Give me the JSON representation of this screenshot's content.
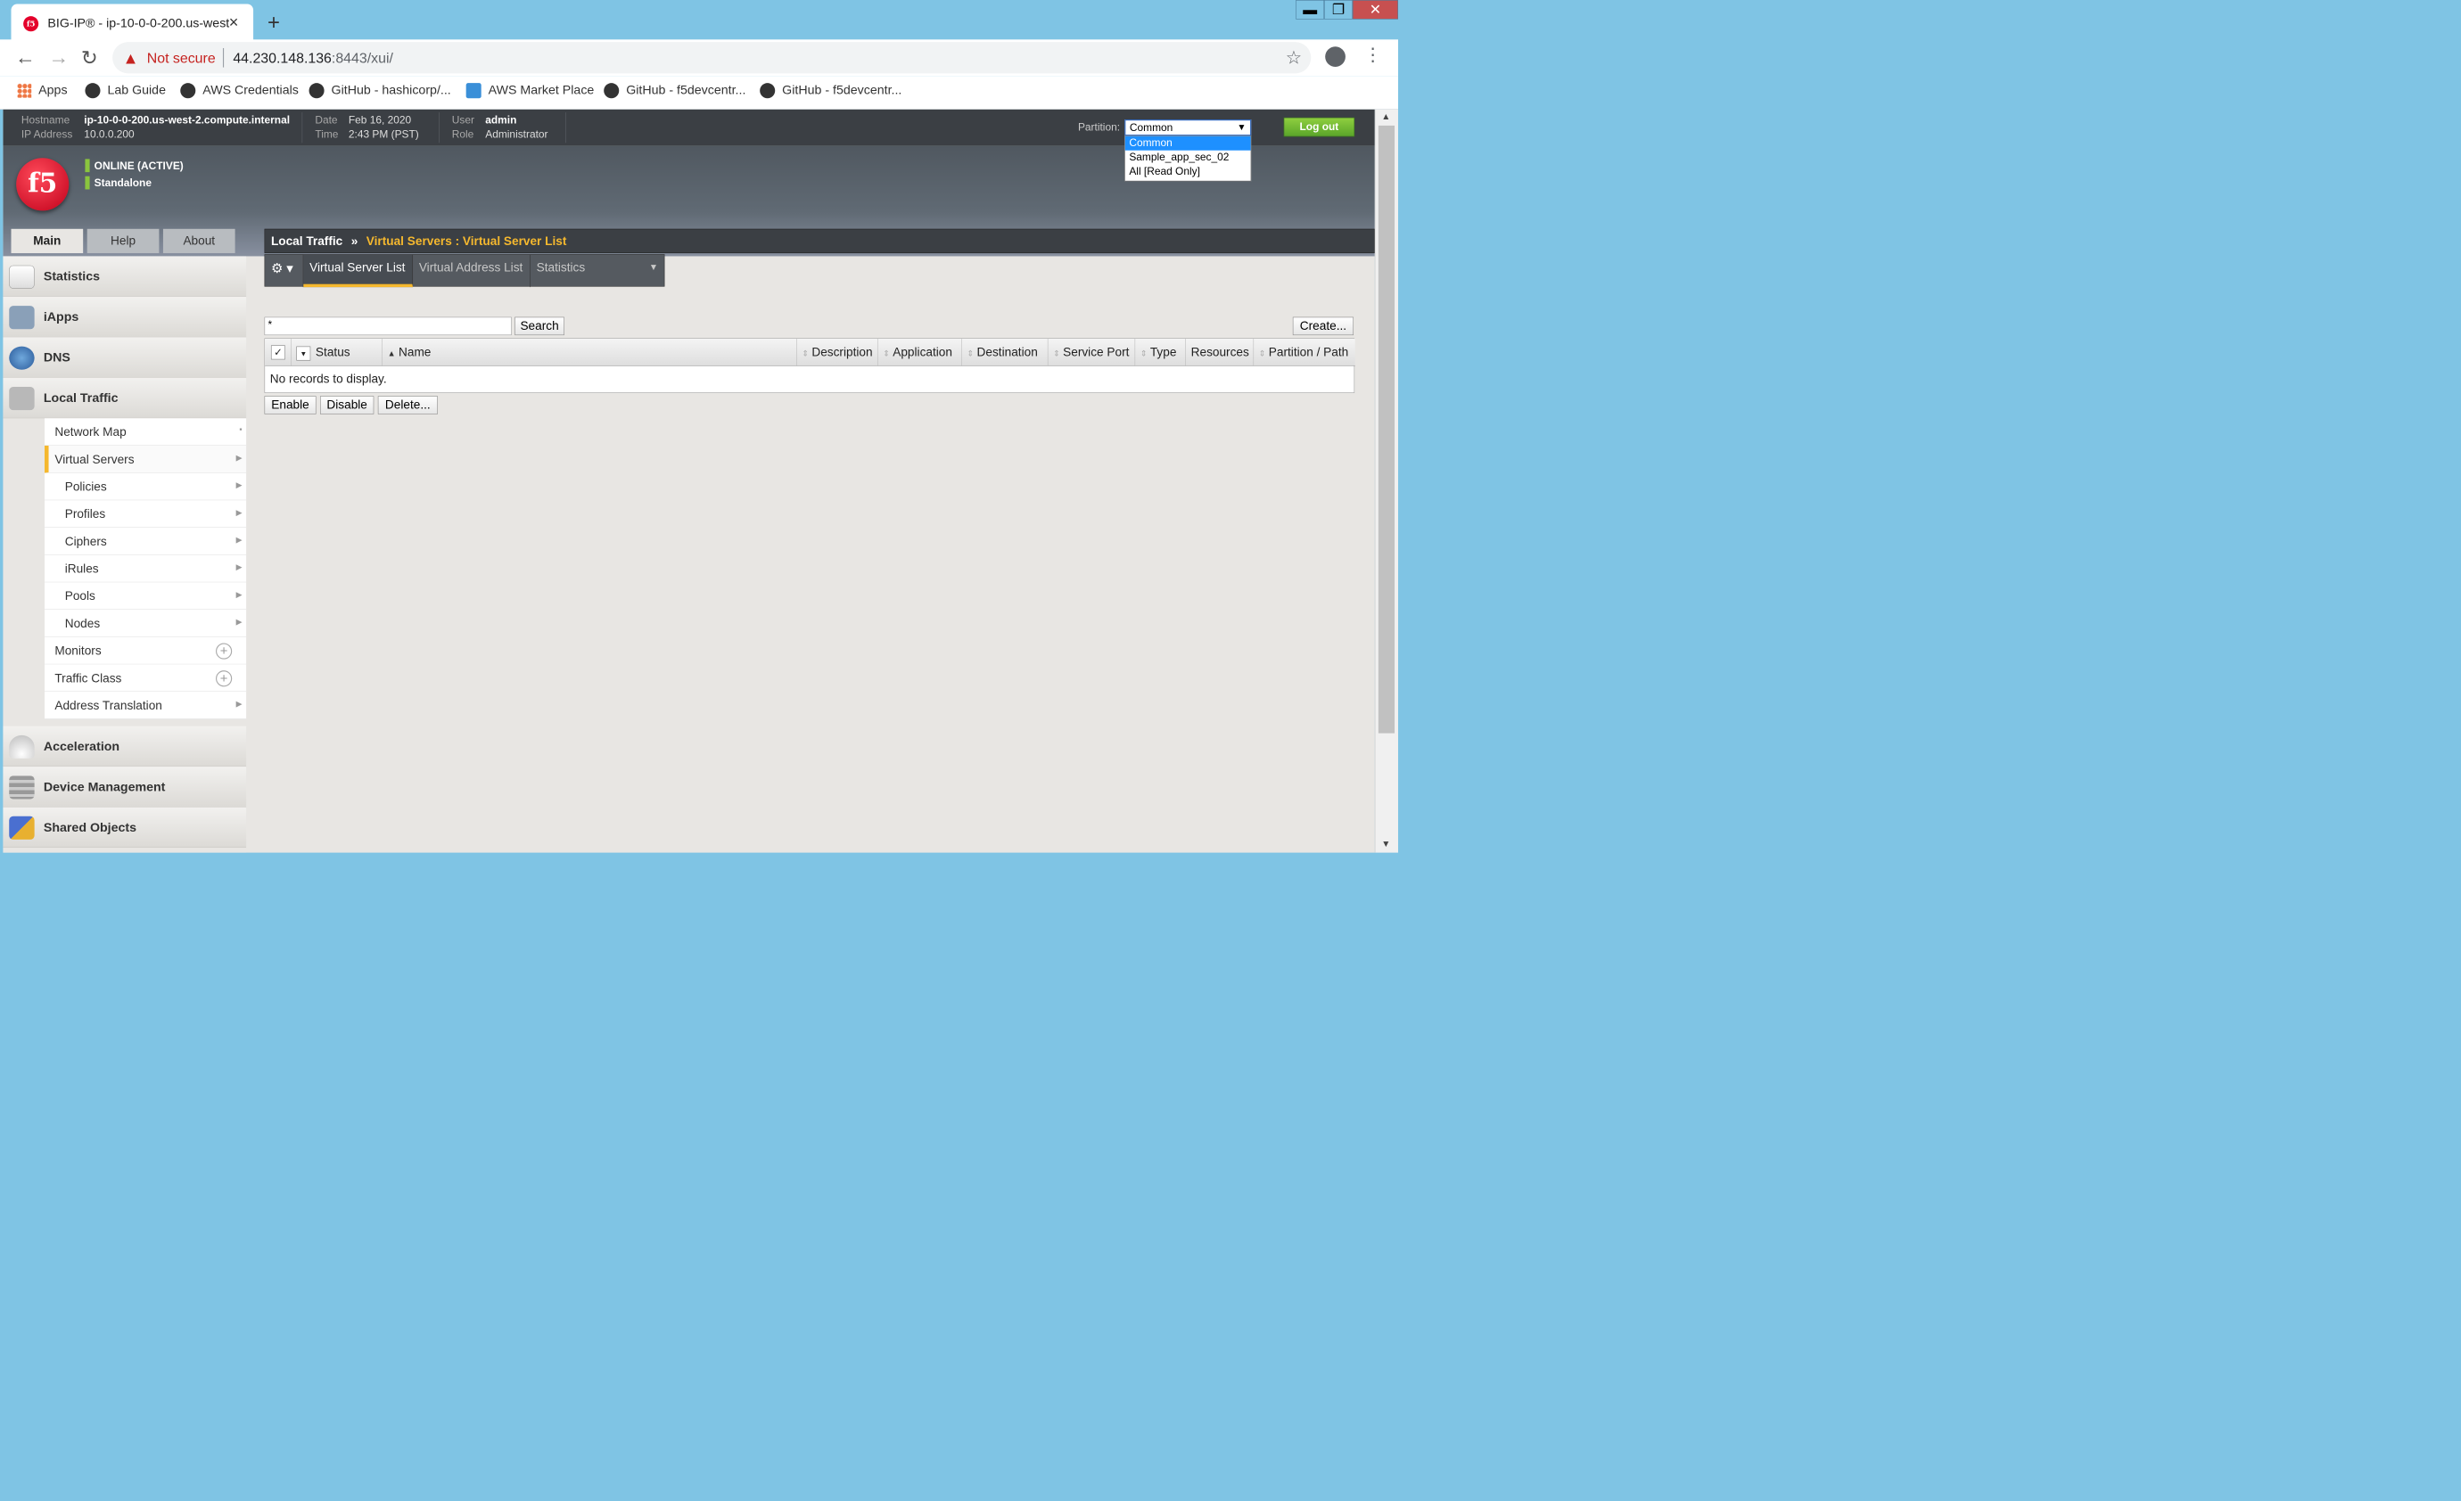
{
  "browser": {
    "tab_title": "BIG-IP® - ip-10-0-0-200.us-west",
    "favicon": "f5",
    "not_secure": "Not secure",
    "url_host": "44.230.148.136",
    "url_rest": ":8443/xui/",
    "bookmarks": [
      "Apps",
      "Lab Guide",
      "AWS Credentials",
      "GitHub - hashicorp/...",
      "AWS Market Place",
      "GitHub - f5devcentr...",
      "GitHub - f5devcentr..."
    ]
  },
  "info": {
    "hostname_label": "Hostname",
    "hostname": "ip-10-0-0-200.us-west-2.compute.internal",
    "ip_label": "IP Address",
    "ip": "10.0.0.200",
    "date_label": "Date",
    "date": "Feb 16, 2020",
    "time_label": "Time",
    "time": "2:43 PM (PST)",
    "user_label": "User",
    "user": "admin",
    "role_label": "Role",
    "role": "Administrator",
    "partition_label": "Partition:",
    "partition_selected": "Common",
    "partition_options": [
      "Common",
      "Sample_app_sec_02",
      "All [Read Only]"
    ],
    "logout": "Log out"
  },
  "status": {
    "online": "ONLINE (ACTIVE)",
    "mode": "Standalone",
    "logo": "f5"
  },
  "navtabs": [
    "Main",
    "Help",
    "About"
  ],
  "sidebar": {
    "sections": [
      "Statistics",
      "iApps",
      "DNS",
      "Local Traffic",
      "Acceleration",
      "Device Management",
      "Shared Objects"
    ],
    "subitems": [
      "Network Map",
      "Virtual Servers",
      "Policies",
      "Profiles",
      "Ciphers",
      "iRules",
      "Pools",
      "Nodes",
      "Monitors",
      "Traffic Class",
      "Address Translation"
    ]
  },
  "breadcrumb": {
    "root": "Local Traffic",
    "sep": "»",
    "path": "Virtual Servers : Virtual Server List"
  },
  "subtabs": [
    "Virtual Server List",
    "Virtual Address List",
    "Statistics"
  ],
  "filter": {
    "value": "*",
    "search": "Search",
    "create": "Create..."
  },
  "grid": {
    "columns": [
      "Status",
      "Name",
      "Description",
      "Application",
      "Destination",
      "Service Port",
      "Type",
      "Resources",
      "Partition / Path"
    ],
    "empty": "No records to display."
  },
  "actions": [
    "Enable",
    "Disable",
    "Delete..."
  ]
}
